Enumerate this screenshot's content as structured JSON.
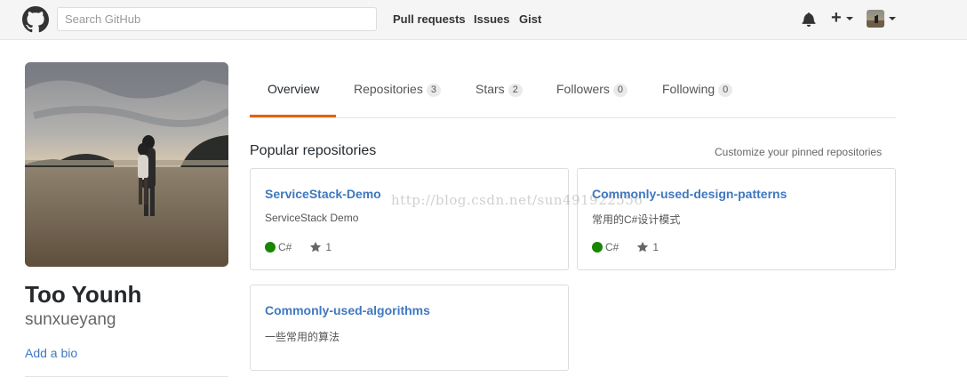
{
  "header": {
    "search_placeholder": "Search GitHub",
    "nav": [
      "Pull requests",
      "Issues",
      "Gist"
    ],
    "icons": [
      "github-mark-icon",
      "bell-icon",
      "plus-icon",
      "chevron-down-icon"
    ]
  },
  "profile": {
    "fullname": "Too Younh",
    "username": "sunxueyang",
    "add_bio": "Add a bio"
  },
  "tabs": [
    {
      "label": "Overview",
      "count": null,
      "selected": true
    },
    {
      "label": "Repositories",
      "count": "3"
    },
    {
      "label": "Stars",
      "count": "2"
    },
    {
      "label": "Followers",
      "count": "0"
    },
    {
      "label": "Following",
      "count": "0"
    }
  ],
  "popular": {
    "title": "Popular repositories",
    "customize": "Customize your pinned repositories",
    "repos": [
      {
        "name": "ServiceStack-Demo",
        "description": "ServiceStack Demo",
        "language": "C#",
        "stars": "1",
        "lang_color": "#178600"
      },
      {
        "name": "Commonly-used-design-patterns",
        "description": "常用的C#设计模式",
        "language": "C#",
        "stars": "1",
        "lang_color": "#178600"
      },
      {
        "name": "Commonly-used-algorithms",
        "description": "一些常用的算法"
      }
    ]
  },
  "watermark": "http://blog.csdn.net/sun491922556",
  "colors": {
    "link": "#4078c0",
    "tab_accent": "#e36209",
    "csharp": "#178600"
  }
}
